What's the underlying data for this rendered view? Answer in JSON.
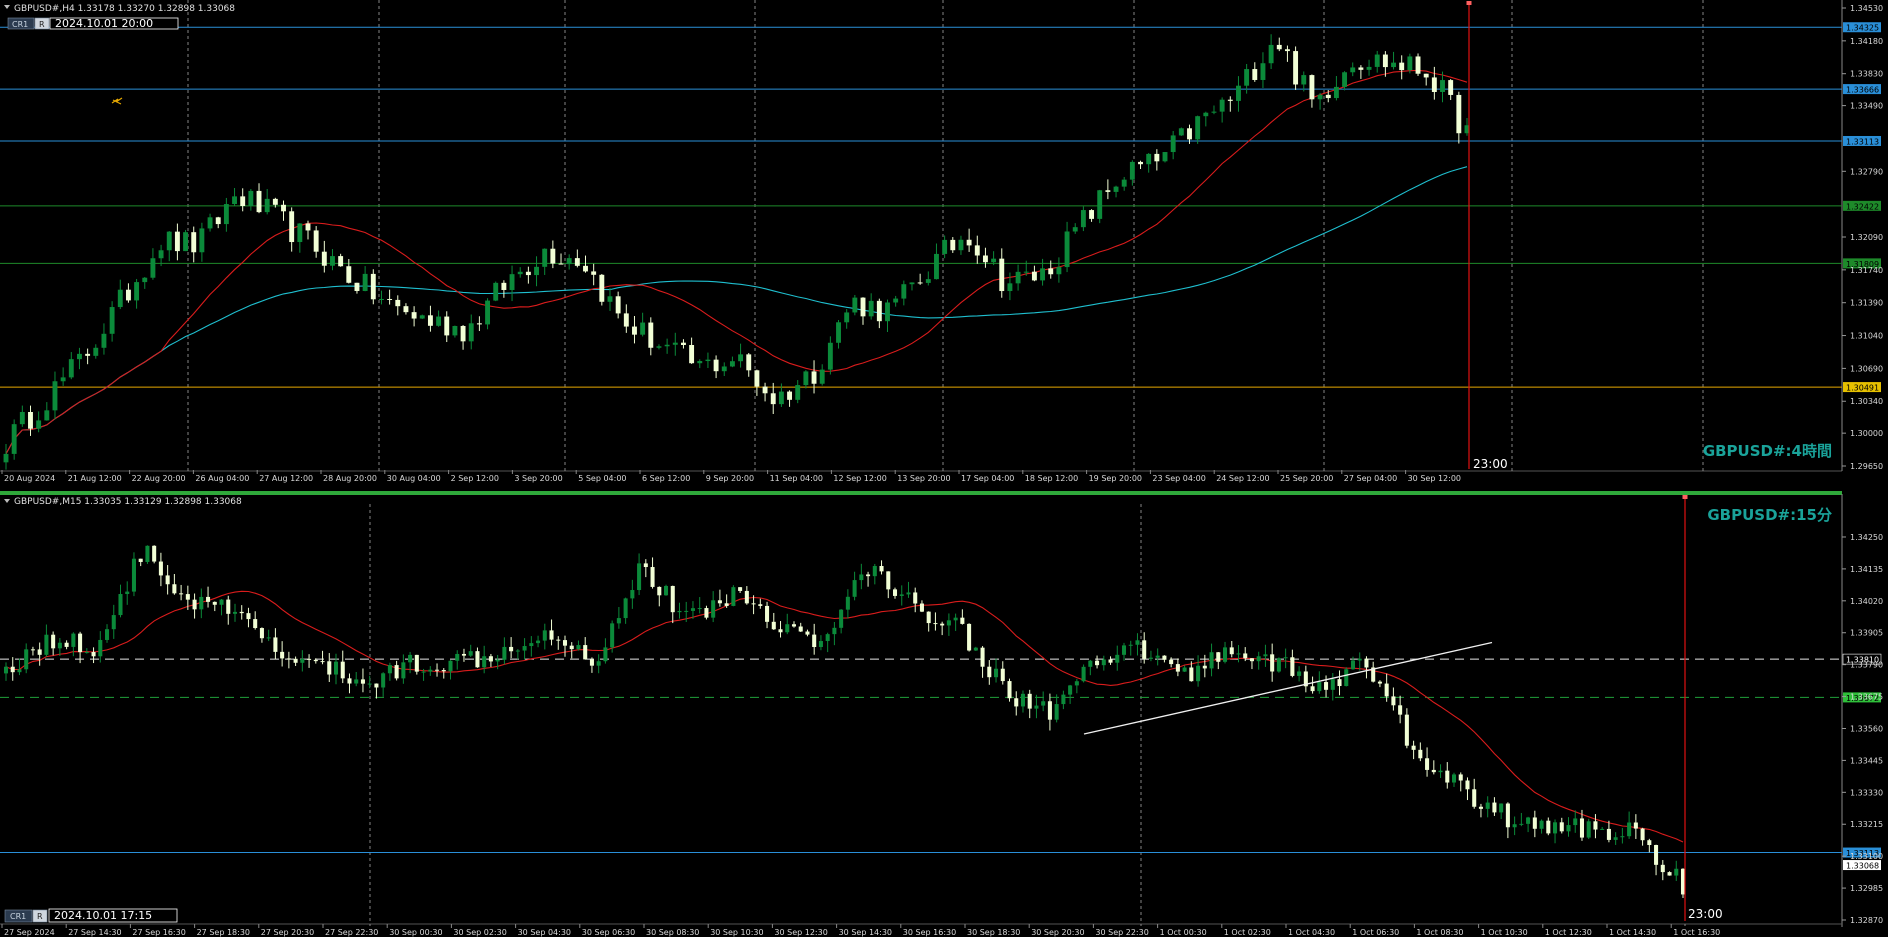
{
  "colors": {
    "background": "#000000",
    "bull_candle": "#0b8a3a",
    "bear_candle": "#f2ffd6",
    "grid": "#b0b0b0",
    "axis_text": "#d8d8d8",
    "ma_fast": "#d91c1c",
    "ma_slow": "#1fbfcf",
    "hline_blue": "#2a8fd8",
    "hline_green": "#1e8a2a",
    "hline_yellow": "#e6a800",
    "vline_red": "#e01010",
    "trendline": "#f0f0f0",
    "watermark": "#1aa39a",
    "sep_green": "#2fa83a"
  },
  "top_panel": {
    "header": "GBPUSD#,H4  1.33178 1.33270 1.32898 1.33068",
    "badge_cr": "CR1",
    "badge_r": "R",
    "datetime_label": "2024.10.01 20:00",
    "watermark": "GBPUSD#:4時間",
    "cursor_time": "23:00",
    "icon": "lightning-object-icon"
  },
  "bottom_panel": {
    "header": "GBPUSD#,M15  1.33035 1.33129 1.32898 1.33068",
    "badge_cr": "CR1",
    "badge_r": "R",
    "datetime_label": "2024.10.01 17:15",
    "watermark": "GBPUSD#:15分",
    "cursor_time": "23:00"
  },
  "chart_data": [
    {
      "type": "candlestick",
      "symbol": "GBPUSD#",
      "timeframe": "H4",
      "ylim": [
        1.2965,
        1.3453
      ],
      "y_ticks": [
        "1.34530",
        "1.34180",
        "1.33830",
        "1.33490",
        "1.32790",
        "1.32090",
        "1.31740",
        "1.31390",
        "1.31040",
        "1.30690",
        "1.30340",
        "1.30000",
        "1.29650"
      ],
      "x_ticks": [
        "20 Aug 2024",
        "21 Aug 12:00",
        "22 Aug 20:00",
        "26 Aug 04:00",
        "27 Aug 12:00",
        "28 Aug 20:00",
        "30 Aug 04:00",
        "2 Sep 12:00",
        "3 Sep 20:00",
        "5 Sep 04:00",
        "6 Sep 12:00",
        "9 Sep 20:00",
        "11 Sep 04:00",
        "12 Sep 12:00",
        "13 Sep 20:00",
        "17 Sep 04:00",
        "18 Sep 12:00",
        "19 Sep 20:00",
        "23 Sep 04:00",
        "24 Sep 12:00",
        "25 Sep 20:00",
        "27 Sep 04:00",
        "30 Sep 12:00"
      ],
      "price_markers": [
        {
          "label": "1.34325",
          "value": 1.34325,
          "color": "blue"
        },
        {
          "label": "1.33666",
          "value": 1.33666,
          "color": "blue"
        },
        {
          "label": "1.33113",
          "value": 1.33113,
          "color": "blue"
        },
        {
          "label": "1.32422",
          "value": 1.32422,
          "color": "green"
        },
        {
          "label": "1.31809",
          "value": 1.31809,
          "color": "green"
        },
        {
          "label": "1.30491",
          "value": 1.30491,
          "color": "yellow"
        }
      ],
      "anchors": [
        1.299,
        1.3035,
        1.308,
        1.314,
        1.3205,
        1.32,
        1.3255,
        1.323,
        1.32,
        1.3165,
        1.3135,
        1.312,
        1.311,
        1.316,
        1.3195,
        1.3185,
        1.312,
        1.3095,
        1.307,
        1.308,
        1.3035,
        1.3065,
        1.314,
        1.313,
        1.3175,
        1.3215,
        1.316,
        1.317,
        1.3225,
        1.3275,
        1.329,
        1.333,
        1.336,
        1.3425,
        1.335,
        1.34,
        1.3395,
        1.3385,
        1.332
      ],
      "candle_count": 180,
      "ma_fast_period": 20,
      "ma_slow_period": 75
    },
    {
      "type": "candlestick",
      "symbol": "GBPUSD#",
      "timeframe": "M15",
      "ylim": [
        1.3287,
        1.3434
      ],
      "y_ticks": [
        "1.34250",
        "1.34135",
        "1.34020",
        "1.33905",
        "1.33790",
        "1.33675",
        "1.33560",
        "1.33445",
        "1.33330",
        "1.33215",
        "1.33100",
        "1.32985",
        "1.32870"
      ],
      "x_ticks": [
        "27 Sep 2024",
        "27 Sep 14:30",
        "27 Sep 16:30",
        "27 Sep 18:30",
        "27 Sep 20:30",
        "27 Sep 22:30",
        "30 Sep 00:30",
        "30 Sep 02:30",
        "30 Sep 04:30",
        "30 Sep 06:30",
        "30 Sep 08:30",
        "30 Sep 10:30",
        "30 Sep 12:30",
        "30 Sep 14:30",
        "30 Sep 16:30",
        "30 Sep 18:30",
        "30 Sep 20:30",
        "30 Sep 22:30",
        "1 Oct 00:30",
        "1 Oct 02:30",
        "1 Oct 04:30",
        "1 Oct 06:30",
        "1 Oct 08:30",
        "1 Oct 10:30",
        "1 Oct 12:30",
        "1 Oct 14:30",
        "1 Oct 16:30"
      ],
      "price_markers": [
        {
          "label": "1.33810",
          "value": 1.3381,
          "color": "white-dashed"
        },
        {
          "label": "1.33672",
          "value": 1.33672,
          "color": "green-dashed"
        },
        {
          "label": "1.33113",
          "value": 1.33113,
          "color": "blue"
        },
        {
          "label": "1.33068",
          "value": 1.33068,
          "color": "current"
        }
      ],
      "anchors": [
        1.3378,
        1.3388,
        1.3385,
        1.342,
        1.3402,
        1.3398,
        1.3383,
        1.3378,
        1.3372,
        1.338,
        1.338,
        1.3385,
        1.3392,
        1.338,
        1.3415,
        1.3395,
        1.3405,
        1.3395,
        1.3385,
        1.3415,
        1.34,
        1.3394,
        1.337,
        1.3362,
        1.3378,
        1.3385,
        1.3375,
        1.3385,
        1.338,
        1.337,
        1.338,
        1.335,
        1.3335,
        1.3325,
        1.332,
        1.332,
        1.3318,
        1.33
      ],
      "candle_count": 250,
      "ma_fast_period": 20,
      "trendline": {
        "from_price": 1.3354,
        "to_price": 1.3387
      }
    }
  ]
}
